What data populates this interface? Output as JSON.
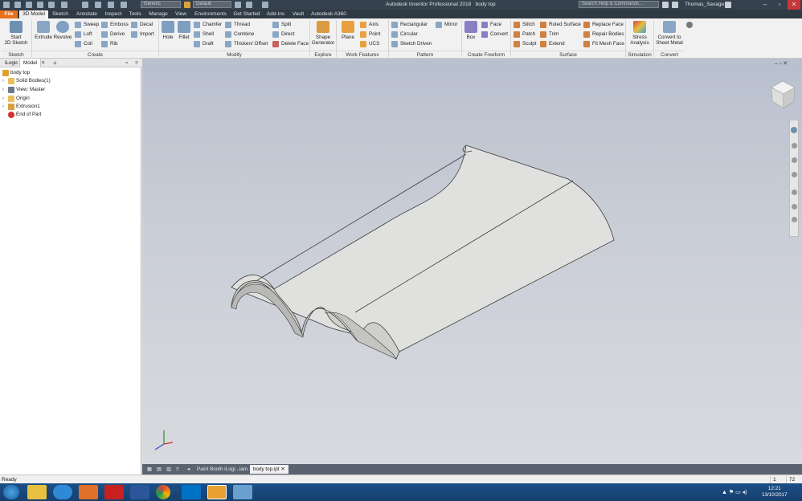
{
  "window": {
    "app_title": "Autodesk Inventor Professional 2018",
    "document_name": "body top",
    "search_placeholder": "Search Help & Commands...",
    "user": "Thomas_Savage",
    "material_combo": "Generic",
    "appearance_combo": "Default"
  },
  "tabs": [
    "File",
    "3D Model",
    "Sketch",
    "Annotate",
    "Inspect",
    "Tools",
    "Manage",
    "View",
    "Environments",
    "Get Started",
    "Add-Ins",
    "Vault",
    "Autodesk A360"
  ],
  "ribbon": {
    "sketch": {
      "start_sketch": "Start\n2D Sketch",
      "group": "Sketch"
    },
    "create": {
      "extrude": "Extrude",
      "revolve": "Revolve",
      "sweep": "Sweep",
      "loft": "Loft",
      "coil": "Coil",
      "emboss": "Emboss",
      "derive": "Derive",
      "rib": "Rib",
      "decal": "Decal",
      "import": "Import",
      "group": "Create"
    },
    "modify": {
      "hole": "Hole",
      "fillet": "Fillet",
      "chamfer": "Chamfer",
      "shell": "Shell",
      "draft": "Draft",
      "thread": "Thread",
      "combine": "Combine",
      "thicken": "Thicken/ Offset",
      "split": "Split",
      "direct": "Direct",
      "delete_face": "Delete Face",
      "group": "Modify"
    },
    "explore": {
      "shape_generator": "Shape\nGenerator",
      "group": "Explore"
    },
    "work_features": {
      "plane": "Plane",
      "axis": "Axis",
      "point": "Point",
      "ucs": "UCS",
      "group": "Work Features"
    },
    "pattern": {
      "rectangular": "Rectangular",
      "circular": "Circular",
      "sketch_driven": "Sketch Driven",
      "mirror": "Mirror",
      "group": "Pattern"
    },
    "freeform": {
      "box": "Box",
      "face": "Face",
      "convert": "Convert",
      "group": "Create Freeform"
    },
    "surface": {
      "stitch": "Stitch",
      "patch": "Patch",
      "sculpt": "Sculpt",
      "ruled_surface": "Ruled Surface",
      "trim": "Trim",
      "extend": "Extend",
      "replace_face": "Replace Face",
      "repair_bodies": "Repair Bodies",
      "fit_mesh_face": "Fit Mesh Face",
      "group": "Surface"
    },
    "simulation": {
      "stress_analysis": "Stress\nAnalysis",
      "group": "Simulation"
    },
    "convert": {
      "sheet_metal": "Convert to\nSheet Metal",
      "group": "Convert"
    }
  },
  "browser": {
    "tabs": [
      "iLogic",
      "Model"
    ],
    "tree": [
      {
        "label": "body top",
        "color": "#e0a030"
      },
      {
        "label": "Solid Bodies(1)",
        "color": "#e8c060"
      },
      {
        "label": "View: Master",
        "color": "#6a7a8a"
      },
      {
        "label": "Origin",
        "color": "#e8c060"
      },
      {
        "label": "Extrusion1",
        "color": "#d8a040"
      },
      {
        "label": "End of Part",
        "color": "#d83030"
      }
    ]
  },
  "doc_tabs": [
    "Paint Booth iLogi...iam",
    "body top.ipt"
  ],
  "status": {
    "text": "Ready",
    "count1": "1",
    "count2": "72"
  },
  "clock": {
    "time": "12:21",
    "date": "13/10/2017"
  },
  "colors": {
    "title_bar": "#35414d",
    "file_tab": "#e8711b",
    "viewport_top": "#b9c0ce",
    "model_face": "#e2e2e0"
  }
}
